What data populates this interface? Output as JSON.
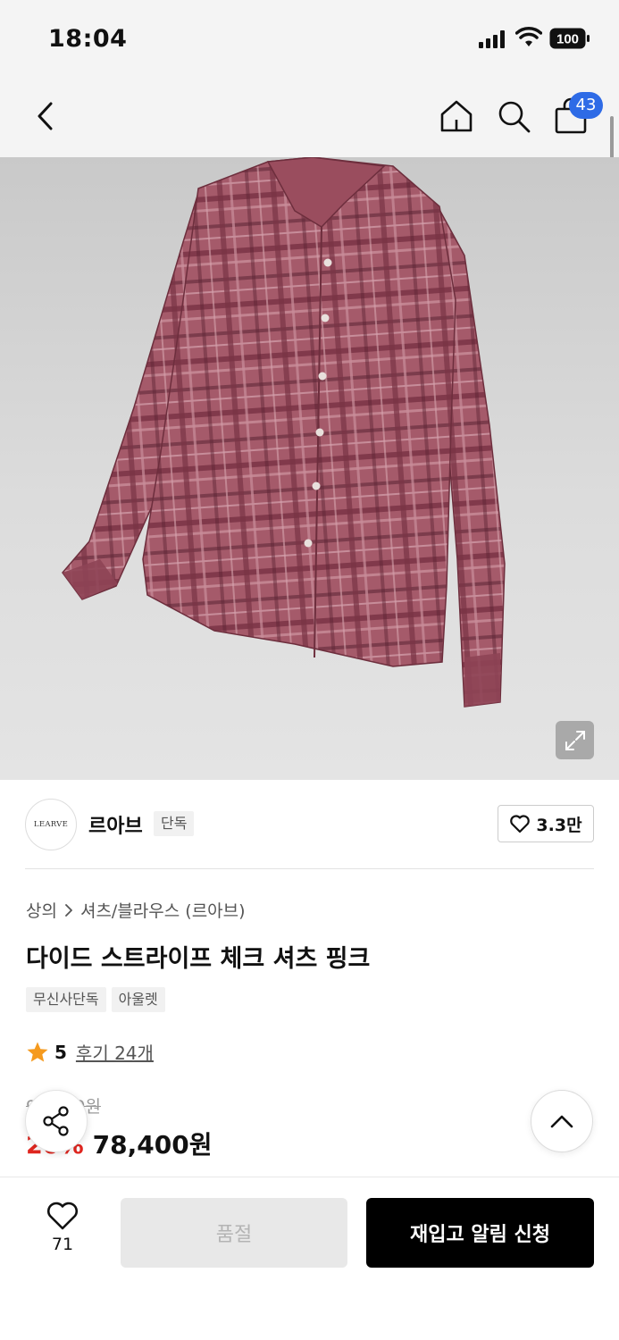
{
  "status_bar": {
    "time": "18:04",
    "battery": "100"
  },
  "nav": {
    "cart_count": "43"
  },
  "product_image": {
    "icons": [
      "expand-icon"
    ]
  },
  "brand": {
    "logo_text": "LEARVE",
    "name": "르아브",
    "tag": "단독",
    "like_count": "3.3만"
  },
  "breadcrumb": {
    "level1": "상의",
    "level2": "셔츠/블라우스 (르아브)"
  },
  "product": {
    "title": "다이드 스트라이프 체크 셔츠 핑크",
    "tags": [
      "무신사단독",
      "아울렛"
    ],
    "rating": "5",
    "review_link": "후기 24개",
    "original_price": "98,000원",
    "discount": "20%",
    "sale_price": "78,400원"
  },
  "bottom_bar": {
    "wish_count": "71",
    "soldout_label": "품절",
    "restock_label": "재입고 알림 신청"
  },
  "colors": {
    "accent_blue": "#2e6be6",
    "discount_red": "#e0261f",
    "star": "#f59a1e",
    "shirt": "#9e5263"
  }
}
